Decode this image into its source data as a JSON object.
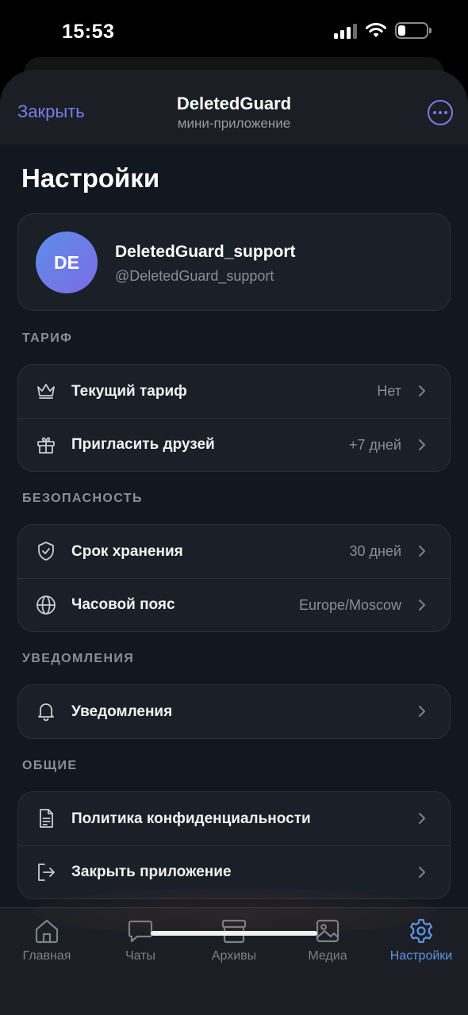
{
  "status_bar": {
    "time": "15:53"
  },
  "header": {
    "close_label": "Закрыть",
    "title": "DeletedGuard",
    "subtitle": "мини-приложение",
    "more_icon": "more-icon"
  },
  "page": {
    "title": "Настройки"
  },
  "profile": {
    "initials": "DE",
    "name": "DeletedGuard_support",
    "handle": "@DeletedGuard_support"
  },
  "sections": {
    "tariff": {
      "label": "ТАРИФ",
      "items": [
        {
          "label": "Текущий тариф",
          "value": "Нет",
          "icon": "crown-icon"
        },
        {
          "label": "Пригласить друзей",
          "value": "+7 дней",
          "icon": "gift-icon"
        }
      ]
    },
    "security": {
      "label": "БЕЗОПАСНОСТЬ",
      "items": [
        {
          "label": "Срок хранения",
          "value": "30 дней",
          "icon": "shield-check-icon"
        },
        {
          "label": "Часовой пояс",
          "value": "Europe/Moscow",
          "icon": "globe-icon"
        }
      ]
    },
    "notifications": {
      "label": "УВЕДОМЛЕНИЯ",
      "items": [
        {
          "label": "Уведомления",
          "icon": "bell-icon"
        }
      ]
    },
    "general": {
      "label": "ОБЩИЕ",
      "items": [
        {
          "label": "Политика конфиденциальности",
          "icon": "document-icon"
        },
        {
          "label": "Закрыть приложение",
          "icon": "logout-icon"
        }
      ]
    }
  },
  "tabbar": {
    "active": "Настройки",
    "active_color": "#5d95e6",
    "tabs": [
      {
        "label": "Главная",
        "icon": "home-icon"
      },
      {
        "label": "Чаты",
        "icon": "chat-icon"
      },
      {
        "label": "Архивы",
        "icon": "archive-icon"
      },
      {
        "label": "Медиа",
        "icon": "image-icon"
      },
      {
        "label": "Настройки",
        "icon": "gear-icon"
      }
    ]
  },
  "colors": {
    "accent": "#7a7dea",
    "background": "#131720",
    "card": "#1b1f27"
  }
}
